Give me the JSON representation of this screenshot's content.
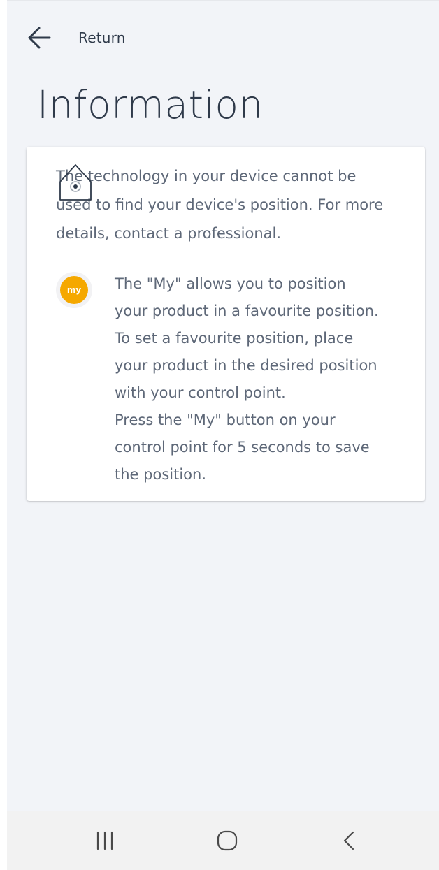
{
  "header": {
    "back_label": "Return",
    "title": "Information"
  },
  "card": {
    "warning": {
      "icon": "house-location-icon",
      "text": "The technology in your device cannot be used to find your device's position. For more details, contact a professional."
    },
    "my_info": {
      "icon": "my-button-icon",
      "icon_label": "my",
      "icon_color": "#f5a800",
      "lines": [
        "The \"My\" allows you to position",
        "your product in a favourite position.",
        "To set a favourite position, place",
        "your product in the desired position",
        "with your control point.",
        "Press the \"My\" button on your",
        "control point for 5 seconds to save",
        "the position."
      ]
    }
  },
  "navbar": {
    "recent_icon": "recent-apps-icon",
    "home_icon": "home-icon",
    "back_icon": "back-icon"
  },
  "colors": {
    "background": "#f2f4f8",
    "text_primary": "#2f3a4a",
    "text_secondary": "#5e6878",
    "accent": "#f5a800"
  }
}
